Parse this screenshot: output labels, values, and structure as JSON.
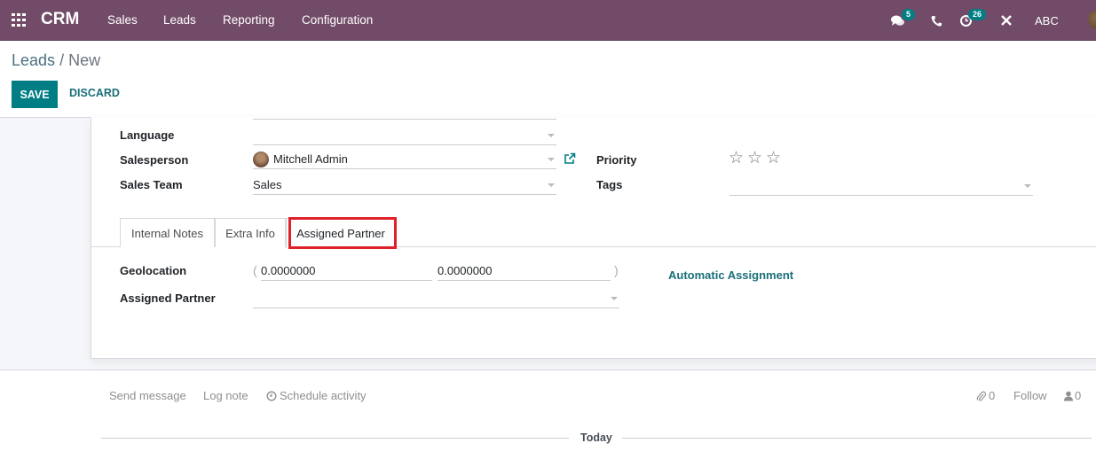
{
  "navbar": {
    "app_name": "CRM",
    "menu": [
      "Sales",
      "Leads",
      "Reporting",
      "Configuration"
    ],
    "messages_badge": "5",
    "activities_badge": "26",
    "company": "ABC",
    "color": "#714b67"
  },
  "breadcrumb": {
    "parent": "Leads",
    "separator": "/",
    "current": "New"
  },
  "actions": {
    "save": "SAVE",
    "discard": "DISCARD"
  },
  "form": {
    "language": {
      "label": "Language",
      "value": ""
    },
    "salesperson": {
      "label": "Salesperson",
      "value": "Mitchell Admin"
    },
    "sales_team": {
      "label": "Sales Team",
      "value": "Sales"
    },
    "priority": {
      "label": "Priority",
      "stars_total": 3,
      "stars_filled": 0
    },
    "tags": {
      "label": "Tags",
      "value": ""
    }
  },
  "tabs": [
    {
      "label": "Internal Notes",
      "active": false
    },
    {
      "label": "Extra Info",
      "active": false
    },
    {
      "label": "Assigned Partner",
      "active": true
    }
  ],
  "assigned_tab": {
    "geolocation": {
      "label": "Geolocation",
      "open_paren": "(",
      "close_paren": ")",
      "latitude": "0.0000000",
      "longitude": "0.0000000"
    },
    "assigned_partner": {
      "label": "Assigned Partner",
      "value": ""
    },
    "automatic_assignment": "Automatic Assignment"
  },
  "chatter": {
    "send_message": "Send message",
    "log_note": "Log note",
    "schedule_activity": "Schedule activity",
    "attachments_count": "0",
    "follow": "Follow",
    "followers_count": "0",
    "today": "Today"
  },
  "colors": {
    "primary": "#017e84",
    "link": "#1a6f78",
    "highlight": "#e0202a"
  }
}
